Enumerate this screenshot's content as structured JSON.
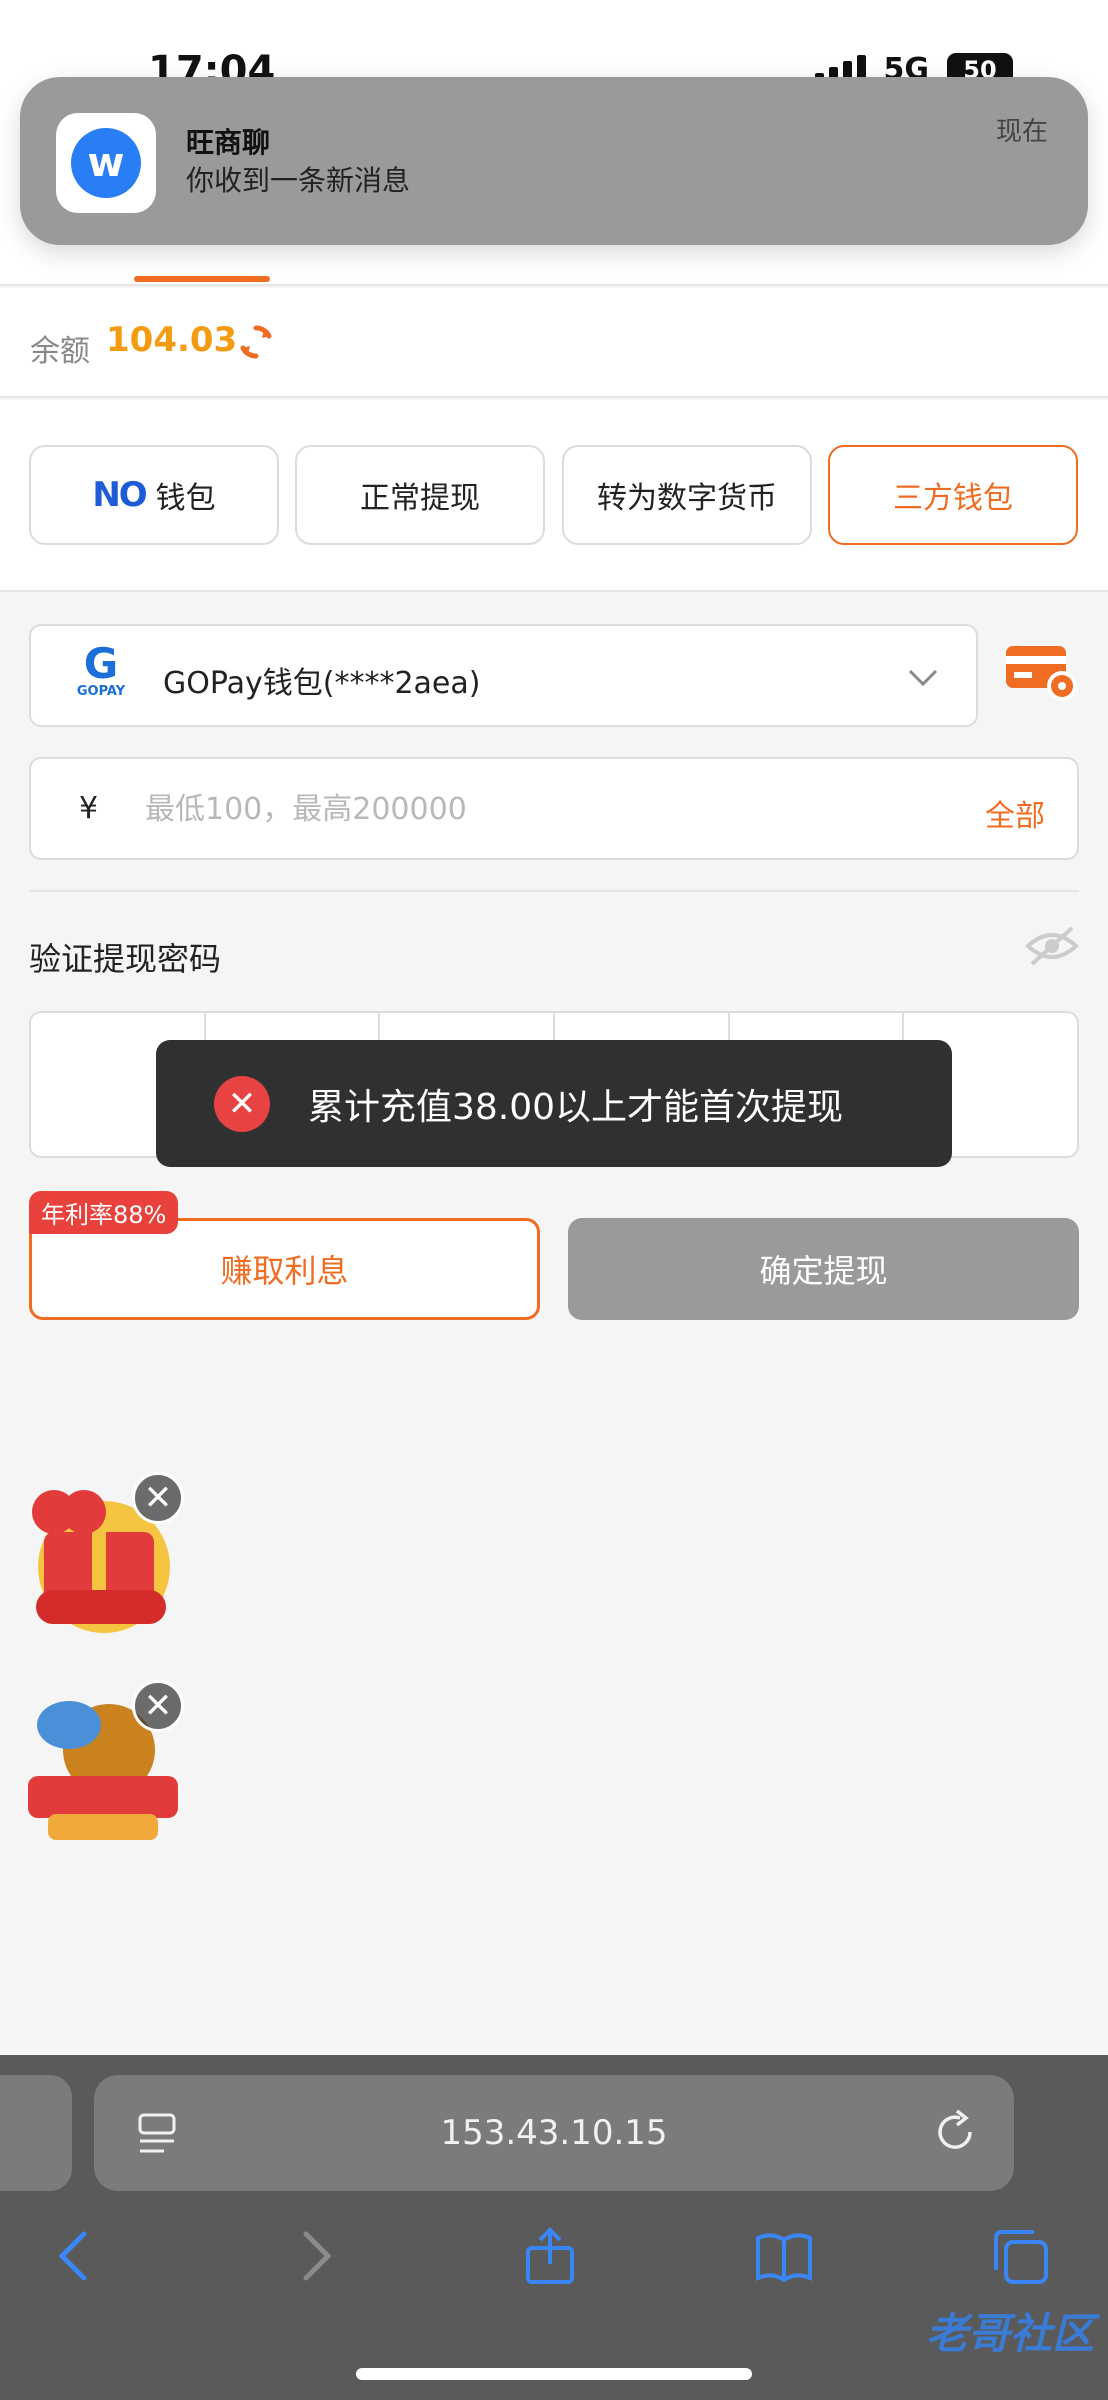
{
  "status_bar": {
    "time": "17:04",
    "network": "5G",
    "battery": "50"
  },
  "notification": {
    "app": "旺商聊",
    "message": "你收到一条新消息",
    "time": "现在",
    "icon": "chat-w-icon"
  },
  "balance": {
    "label": "余额",
    "value": "104.03"
  },
  "methods": [
    {
      "label": "钱包",
      "logo": "NO",
      "active": false
    },
    {
      "label": "正常提现",
      "active": false
    },
    {
      "label": "转为数字货币",
      "active": false
    },
    {
      "label": "三方钱包",
      "active": true
    }
  ],
  "wallet": {
    "logo_text": "GOPAY",
    "label": "GOPay钱包(****2aea)"
  },
  "amount": {
    "currency": "¥",
    "placeholder": "最低100，最高200000",
    "all": "全部"
  },
  "password": {
    "label": "验证提现密码"
  },
  "toast": {
    "message": "累计充值38.00以上才能首次提现"
  },
  "actions": {
    "badge": "年利率88%",
    "earn": "赚取利息",
    "confirm": "确定提现"
  },
  "browser": {
    "url": "153.43.10.15"
  },
  "watermark": "老哥社区",
  "colors": {
    "accent": "#f06c23",
    "balance": "#f39c12",
    "error": "#e84343",
    "brand_blue": "#1a6fd8"
  }
}
